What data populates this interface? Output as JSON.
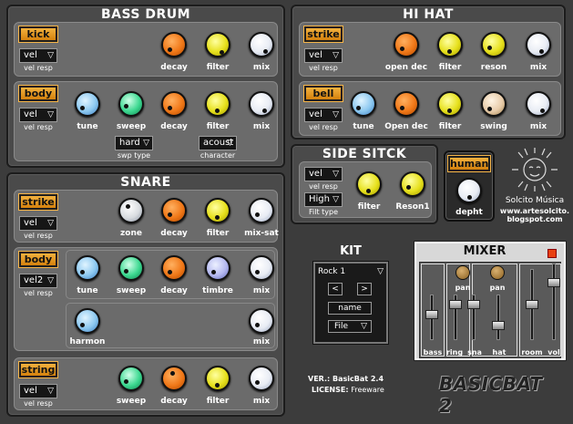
{
  "bass_drum": {
    "title": "BASS DRUM",
    "kick": {
      "label": "kick",
      "sel": "vel",
      "sel_label": "vel resp",
      "knobs": [
        "decay",
        "filter",
        "mix"
      ]
    },
    "body": {
      "label": "body",
      "sel": "vel",
      "sel_label": "vel resp",
      "knobs": [
        "tune",
        "sweep",
        "decay",
        "filter",
        "mix"
      ],
      "swp": "hard",
      "swp_label": "swp type",
      "char": "acoust",
      "char_label": "character"
    }
  },
  "hi_hat": {
    "title": "HI HAT",
    "strike": {
      "label": "strike",
      "sel": "vel",
      "sel_label": "vel resp",
      "knobs": [
        "open dec",
        "filter",
        "reson",
        "mix"
      ]
    },
    "bell": {
      "label": "bell",
      "sel": "vel",
      "sel_label": "vel resp",
      "knobs": [
        "tune",
        "Open dec",
        "filter",
        "swing",
        "mix"
      ]
    }
  },
  "side_stick": {
    "title": "SIDE SITCK",
    "sel": "vel",
    "sel_label": "vel resp",
    "filt": "High",
    "filt_label": "Filt type",
    "knobs": [
      "filter",
      "Reson1"
    ]
  },
  "human": {
    "label": "human",
    "knob": "depht"
  },
  "logo": {
    "name": "Solcito Música",
    "url1": "www.artesolcito.",
    "url2": "blogspot.com"
  },
  "snare": {
    "title": "SNARE",
    "strike": {
      "label": "strike",
      "sel": "vel",
      "sel_label": "vel resp",
      "knobs": [
        "zone",
        "decay",
        "filter",
        "mix-sat"
      ]
    },
    "body": {
      "label": "body",
      "sel": "vel2",
      "sel_label": "vel resp",
      "knobs": [
        "tune",
        "sweep",
        "decay",
        "timbre",
        "mix"
      ],
      "knobs2": [
        "harmon",
        "mix"
      ]
    },
    "string": {
      "label": "string",
      "sel": "vel",
      "sel_label": "vel resp",
      "knobs": [
        "sweep",
        "decay",
        "filter",
        "mix"
      ]
    }
  },
  "kit": {
    "title": "KIT",
    "preset": "Rock 1",
    "prev": "<",
    "next": ">",
    "name": "name",
    "file": "File"
  },
  "mixer": {
    "title": "MIXER",
    "pan1": "pan",
    "pan2": "pan",
    "channels": [
      "bass",
      "ring",
      "sna",
      "hat",
      "room",
      "vol"
    ]
  },
  "version": {
    "ver_label": "VER.:",
    "ver": "BasicBat 2.4",
    "lic_label": "LICENSE:",
    "lic": "Freeware"
  },
  "brand": "BASICBAT 2"
}
